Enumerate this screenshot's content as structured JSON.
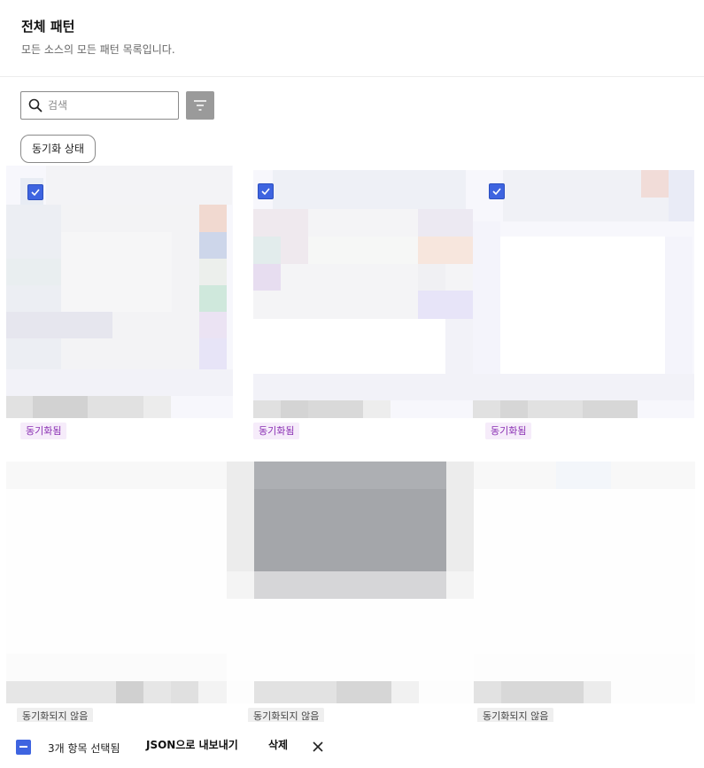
{
  "header": {
    "title": "전체 패턴",
    "subtitle": "모든 소스의 모든 패턴 목록입니다."
  },
  "search": {
    "placeholder": "검색",
    "value": ""
  },
  "filter_chip": {
    "label": "동기화 상태"
  },
  "cards": [
    {
      "selected": true,
      "status": "동기화됨"
    },
    {
      "selected": true,
      "status": "동기화됨"
    },
    {
      "selected": true,
      "status": "동기화됨"
    },
    {
      "selected": false,
      "status": "동기화되지 않음"
    },
    {
      "selected": false,
      "status": "동기화되지 않음"
    },
    {
      "selected": false,
      "status": "동기화되지 않음"
    }
  ],
  "action_bar": {
    "selected_count": "3개 항목 선택됨",
    "export_label": "JSON으로 내보내기",
    "delete_label": "삭제"
  },
  "colors": {
    "accent": "#3e64e0",
    "synced_badge_bg": "#f6ecfa",
    "synced_badge_text": "#8a2fb3",
    "unsynced_badge_bg": "#efefef",
    "filter_button_bg": "#9a9a9a"
  },
  "icons": {
    "search": "search-icon",
    "filter": "filter-icon",
    "check": "check-icon",
    "close": "close-icon"
  }
}
